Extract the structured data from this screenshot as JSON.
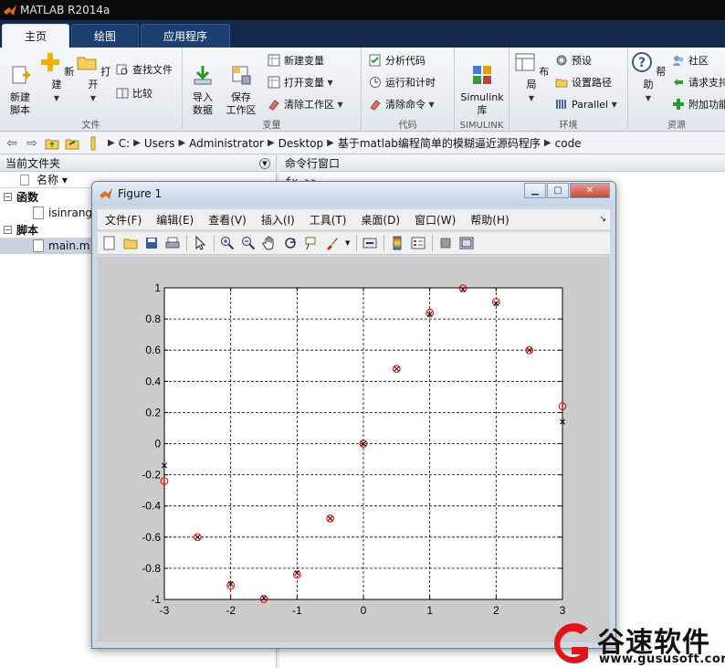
{
  "app": {
    "title": "MATLAB R2014a"
  },
  "tabs": [
    {
      "label": "主页",
      "active": true
    },
    {
      "label": "绘图",
      "active": false
    },
    {
      "label": "应用程序",
      "active": false
    }
  ],
  "ribbon": {
    "file_group": {
      "label": "文件",
      "new_script": "新建\n脚本",
      "new": "新建",
      "open": "打开",
      "find_files": "查找文件",
      "compare": "比较"
    },
    "variable_group": {
      "label": "变量",
      "import_data": "导入\n数据",
      "save_workspace": "保存\n工作区",
      "new_variable": "新建变量",
      "open_variable": "打开变量",
      "clear_workspace": "清除工作区"
    },
    "code_group": {
      "label": "代码",
      "analyze_code": "分析代码",
      "run_and_time": "运行和计时",
      "clear_commands": "清除命令"
    },
    "simulink_group": {
      "label": "SIMULINK",
      "simulink_library": "Simulink\n库"
    },
    "environment_group": {
      "label": "环境",
      "layout": "布局",
      "preferences": "预设",
      "set_path": "设置路径",
      "parallel": "Parallel"
    },
    "resources_group": {
      "label": "资源",
      "help": "帮助",
      "community": "社区",
      "request_support": "请求支持",
      "add_ons": "附加功能"
    }
  },
  "address": {
    "path": [
      "C:",
      "Users",
      "Administrator",
      "Desktop",
      "基于matlab编程简单的模糊逼近源码程序",
      "code"
    ]
  },
  "current_folder": {
    "title": "当前文件夹",
    "column_name": "名称 ▾",
    "groups": [
      {
        "label": "函数",
        "items": [
          "isinrange.m"
        ]
      },
      {
        "label": "脚本",
        "items": [
          "main.m"
        ]
      }
    ]
  },
  "command_window": {
    "title": "命令行窗口",
    "prompt": "fx >>"
  },
  "figure": {
    "title": "Figure 1",
    "menu": [
      "文件(F)",
      "编辑(E)",
      "查看(V)",
      "插入(I)",
      "工具(T)",
      "桌面(D)",
      "窗口(W)",
      "帮助(H)"
    ],
    "toolbar_icons": [
      "new-figure-icon",
      "open-file-icon",
      "save-icon",
      "print-icon",
      "pointer-icon",
      "zoom-in-icon",
      "zoom-out-icon",
      "pan-icon",
      "rotate-icon",
      "data-cursor-icon",
      "brush-icon",
      "link-icon",
      "colorbar-icon",
      "legend-icon",
      "hide-tools-icon",
      "show-tools-icon"
    ]
  },
  "chart_data": {
    "type": "scatter",
    "title": "",
    "xlabel": "",
    "ylabel": "",
    "xlim": [
      -3,
      3
    ],
    "ylim": [
      -1,
      1
    ],
    "xticks": [
      -3,
      -2,
      -1,
      0,
      1,
      2,
      3
    ],
    "yticks": [
      -1,
      -0.8,
      -0.6,
      -0.4,
      -0.2,
      0,
      0.2,
      0.4,
      0.6,
      0.8,
      1
    ],
    "grid": "dashed",
    "series": [
      {
        "marker": "circle",
        "color": "#ff0000",
        "x": [
          -3,
          -2.5,
          -2,
          -1.5,
          -1,
          -0.5,
          0,
          0.5,
          1,
          1.5,
          2,
          2.5,
          3
        ],
        "y": [
          -0.24,
          -0.6,
          -0.91,
          -0.997,
          -0.84,
          -0.48,
          0,
          0.48,
          0.84,
          0.997,
          0.91,
          0.6,
          0.24
        ]
      },
      {
        "marker": "x",
        "color": "#000000",
        "x": [
          -3,
          -2.5,
          -2,
          -1.5,
          -1,
          -0.5,
          0,
          0.5,
          1,
          1.5,
          2,
          2.5,
          3
        ],
        "y": [
          -0.14,
          -0.6,
          -0.9,
          -0.99,
          -0.83,
          -0.48,
          0,
          0.48,
          0.83,
          0.99,
          0.9,
          0.6,
          0.14
        ]
      }
    ]
  },
  "watermark": {
    "name": "谷速软件",
    "url": "www.gususoft.com"
  }
}
